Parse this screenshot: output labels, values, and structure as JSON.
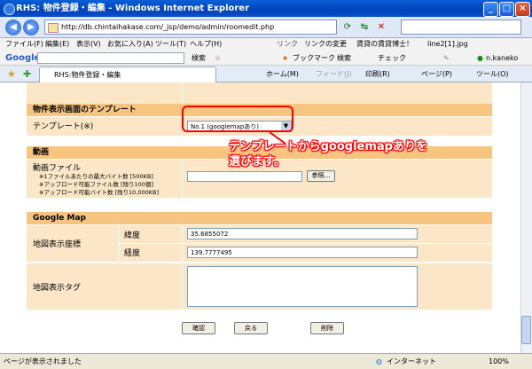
{
  "window": {
    "title": "RHS: 物件登録・編集 - Windows Internet Explorer"
  },
  "address": {
    "url": "http://db.chintaihakase.com/_jsp/demo/admin/roomedit.php",
    "search_text": ""
  },
  "menu": [
    "ファイル(F)",
    "編集(E)",
    "表示(V)",
    "お気に入り(A)",
    "ツール(T)",
    "ヘルプ(H)"
  ],
  "links": {
    "label": "リンク",
    "items": [
      "リンクの変更",
      "賃貸の賃貸博士！",
      "line2[1].jpg"
    ]
  },
  "google_toolbar": {
    "logo": "Google",
    "search_label": "検索",
    "bookmark_label": "ブックマーク",
    "search2_label": "検索",
    "check_label": "チェック",
    "user": "n.kaneko"
  },
  "tab": {
    "title": "RHS:物件登録・編集",
    "home": "ホーム(M)",
    "feed": "フィード(J)",
    "print": "印刷(R)",
    "page": "ページ(P)",
    "tools": "ツール(O)"
  },
  "form": {
    "template_section": {
      "header": "物件表示画面のテンプレート",
      "label": "テンプレート(※)",
      "selected": "No.1 (googlemapあり)"
    },
    "video_section": {
      "header": "動画",
      "label": "動画ファイル",
      "note1": "※1ファイルあたりの最大バイト数 [500KB]",
      "note2": "※アップロード可能ファイル数 [残り100個]",
      "note3": "※アップロード可能バイト数 [残り10,000KB]",
      "browse_label": "参照..."
    },
    "map_section": {
      "header": "Google Map",
      "coords_label": "地図表示座標",
      "lat_label": "緯度",
      "lat_value": "35.6855072",
      "lng_label": "経度",
      "lng_value": "139.7777495",
      "tag_label": "地図表示タグ"
    },
    "buttons": {
      "confirm": "確認",
      "back": "戻る",
      "delete": "削除"
    }
  },
  "annotation": {
    "line1": "テンプレートからgooglemapありを",
    "line2": "選びます。"
  },
  "status": {
    "text": "ページが表示されました",
    "zone": "インターネット",
    "zoom": "100%"
  }
}
